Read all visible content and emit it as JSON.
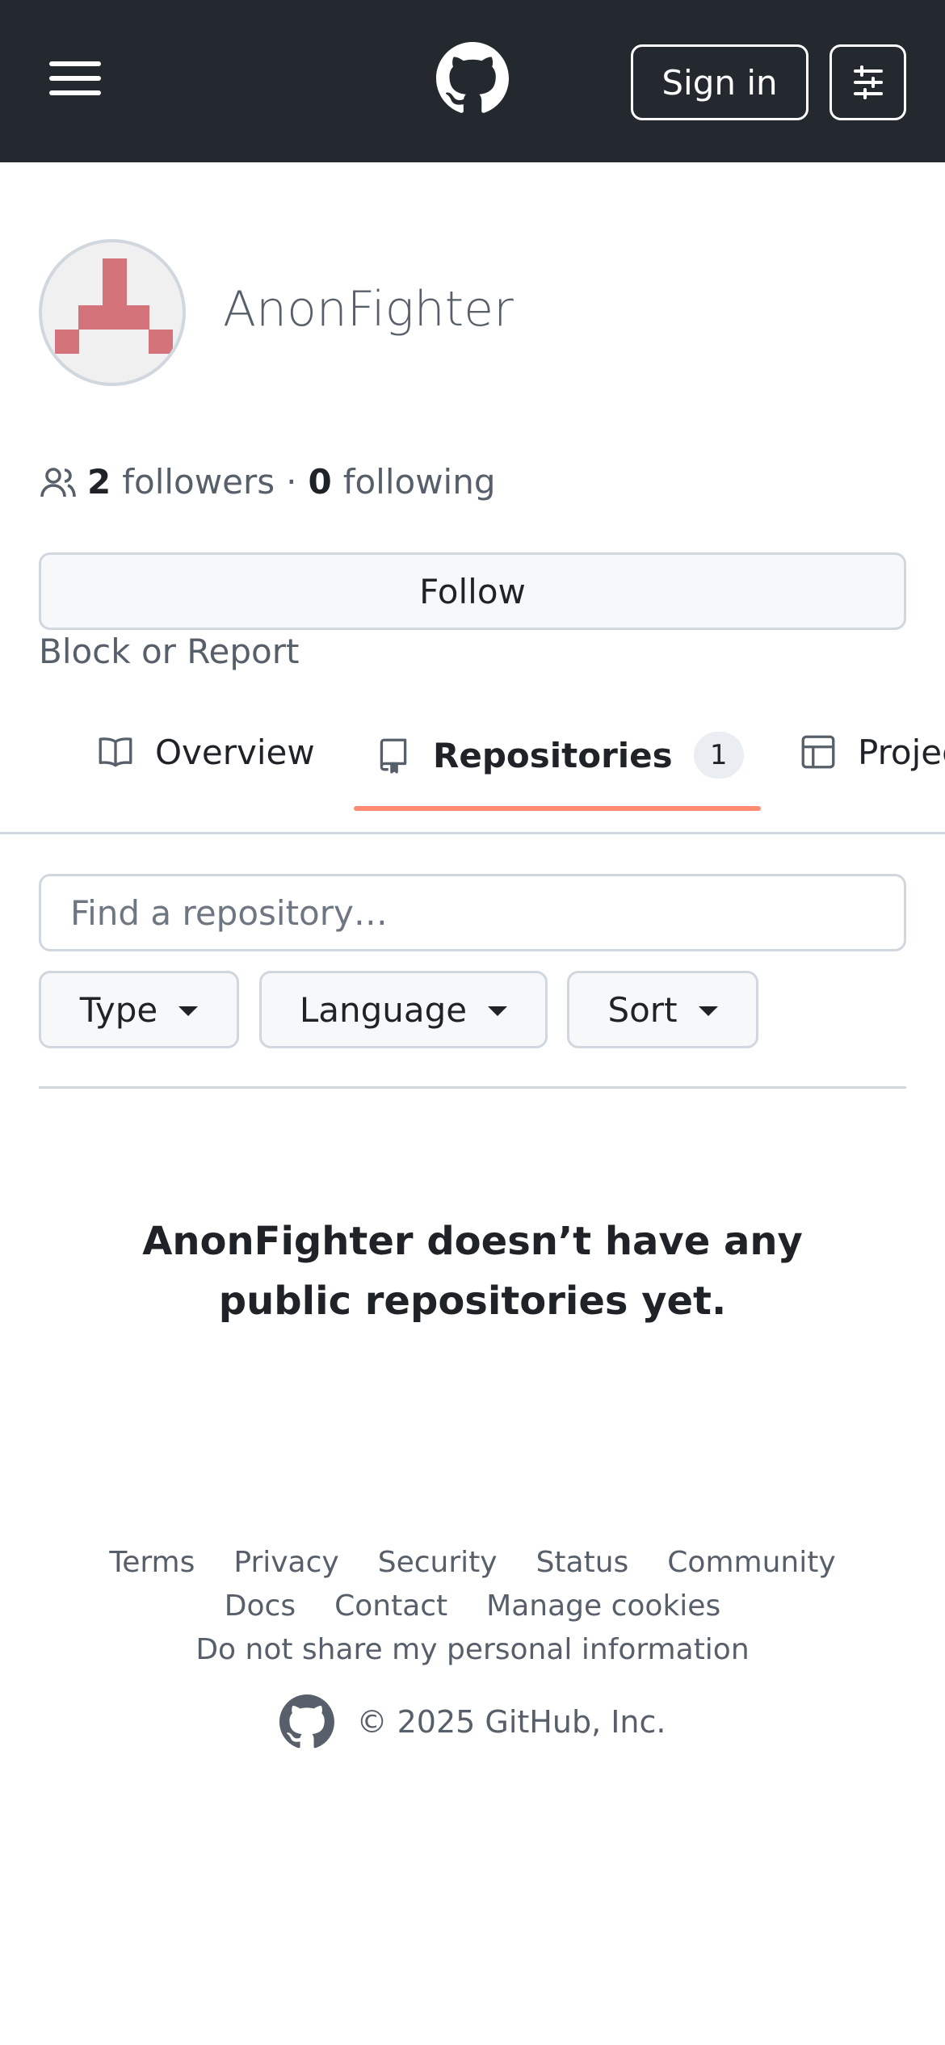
{
  "header": {
    "menu_icon": "hamburger-menu-icon",
    "logo_icon": "github-mark-icon",
    "signin_label": "Sign in",
    "settings_icon": "sliders-icon"
  },
  "profile": {
    "avatar_icon": "identicon-avatar",
    "avatar_color": "#d4737a",
    "username": "AnonFighter",
    "followers_count": "2",
    "followers_label": "followers",
    "separator": "·",
    "following_count": "0",
    "following_label": "following",
    "follow_label": "Follow",
    "block_report_label": "Block or Report"
  },
  "tabs": [
    {
      "label": "Overview",
      "icon": "book-icon"
    },
    {
      "label": "Repositories",
      "icon": "repo-icon",
      "count": "1",
      "active": true
    },
    {
      "label": "Projects",
      "icon": "table-icon"
    }
  ],
  "accent_color": "#fd8c73",
  "search": {
    "placeholder": "Find a repository…"
  },
  "filters": {
    "type_label": "Type",
    "language_label": "Language",
    "sort_label": "Sort"
  },
  "empty_state": {
    "message": "AnonFighter doesn’t have any public repositories yet."
  },
  "footer": {
    "links_row1": [
      "Terms",
      "Privacy",
      "Security",
      "Status",
      "Community"
    ],
    "links_row2": [
      "Docs",
      "Contact",
      "Manage cookies"
    ],
    "links_row3": [
      "Do not share my personal information"
    ],
    "copyright": "© 2025 GitHub, Inc."
  }
}
